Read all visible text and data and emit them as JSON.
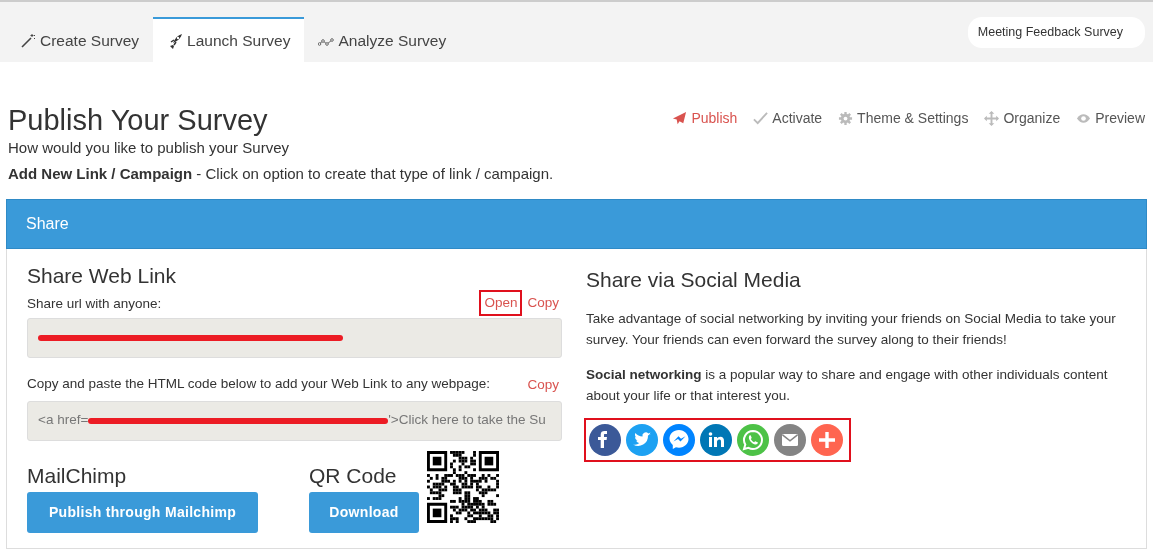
{
  "tabs": [
    {
      "label": "Create Survey",
      "kind": "wand",
      "selected": false
    },
    {
      "label": "Launch Survey",
      "kind": "rocket",
      "selected": true
    },
    {
      "label": "Analyze Survey",
      "kind": "chart",
      "selected": false
    }
  ],
  "survey_name": "Meeting Feedback Survey",
  "page": {
    "title": "Publish Your Survey",
    "subtitle": "How would you like to publish your Survey",
    "instruction": "**Add New Link / Campaign** - Click on option to create that type of link / campaign."
  },
  "steps": [
    {
      "label": "Publish",
      "kind": "plane",
      "selected": true
    },
    {
      "label": "Activate",
      "kind": "check",
      "selected": false
    },
    {
      "label": "Theme & Settings",
      "kind": "gear",
      "selected": false
    },
    {
      "label": "Organize",
      "kind": "move",
      "selected": false
    },
    {
      "label": "Preview",
      "kind": "eye",
      "selected": false
    }
  ],
  "panel": {
    "title": "Share",
    "web_link": {
      "title": "Share Web Link",
      "url_label": "Share url with anyone:",
      "links": [
        {
          "label": "Open",
          "highlighted": true
        },
        {
          "label": "Copy",
          "highlighted": false
        }
      ],
      "url_redacted": true,
      "html_label": "Copy and paste the HTML code below to add your Web Link to any webpage:",
      "html_copy": "Copy",
      "html_before": "<a href=",
      "html_after": "'>Click here to take the Su"
    },
    "mailchimp": {
      "title": "MailChimp",
      "button": "Publish through Mailchimp"
    },
    "qr": {
      "title": "QR Code",
      "button": "Download"
    },
    "social": {
      "title": "Share via Social Media",
      "paragraphs": [
        "Take advantage of social networking by inviting your friends on Social Media to take your survey. Your friends can even forward the survey along to their friends!",
        "**Social networking** is a popular way to share and engage with other individuals content about your life or that interest you."
      ],
      "highlighted": true,
      "icons": [
        {
          "kind": "facebook",
          "color": "#3b5998"
        },
        {
          "kind": "twitter",
          "color": "#1da1f2"
        },
        {
          "kind": "messenger",
          "color": "#0084ff"
        },
        {
          "kind": "linkedin",
          "color": "#0077b5"
        },
        {
          "kind": "whatsapp",
          "color": "#4dc247"
        },
        {
          "kind": "email",
          "color": "#848484"
        },
        {
          "kind": "more",
          "color": "#ff6550"
        }
      ]
    }
  }
}
